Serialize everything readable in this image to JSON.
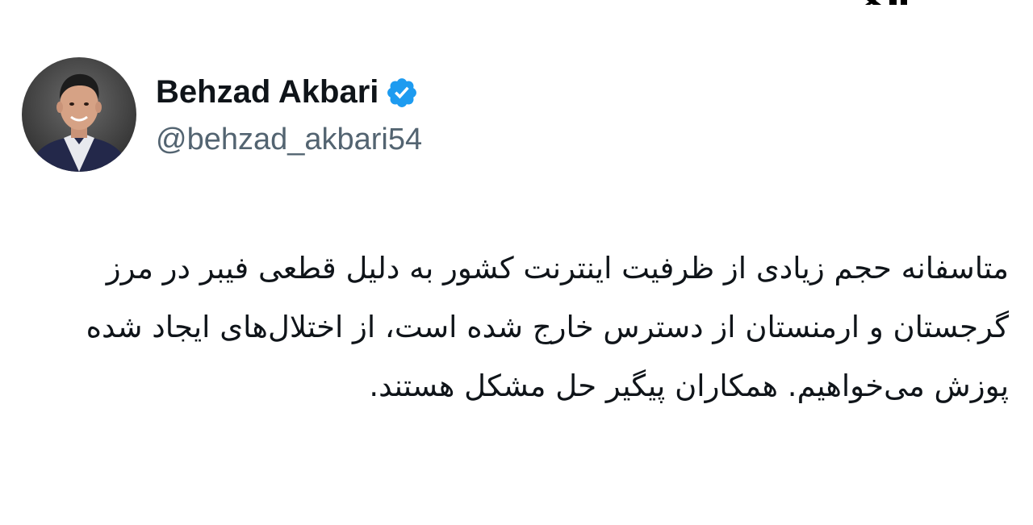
{
  "tweet": {
    "author_name": "Behzad Akbari",
    "author_handle": "@behzad_akbari54",
    "verified": true,
    "text": "متاسفانه حجم زیادی از ظرفیت اینترنت کشور به دلیل قطعی فیبر در مرز گرجستان و ارمنستان از دسترس خارج شده است، از اختلال‌های ایجاد شده پوزش می‌خواهیم. همکاران پیگیر حل مشکل هستند."
  },
  "icons": {
    "logo": "x-logo-icon",
    "verified": "verified-badge-icon",
    "avatar": "profile-photo"
  },
  "colors": {
    "verified_blue": "#1d9bf0",
    "handle_gray": "#536471",
    "text": "#0f1419",
    "background": "#ffffff"
  }
}
